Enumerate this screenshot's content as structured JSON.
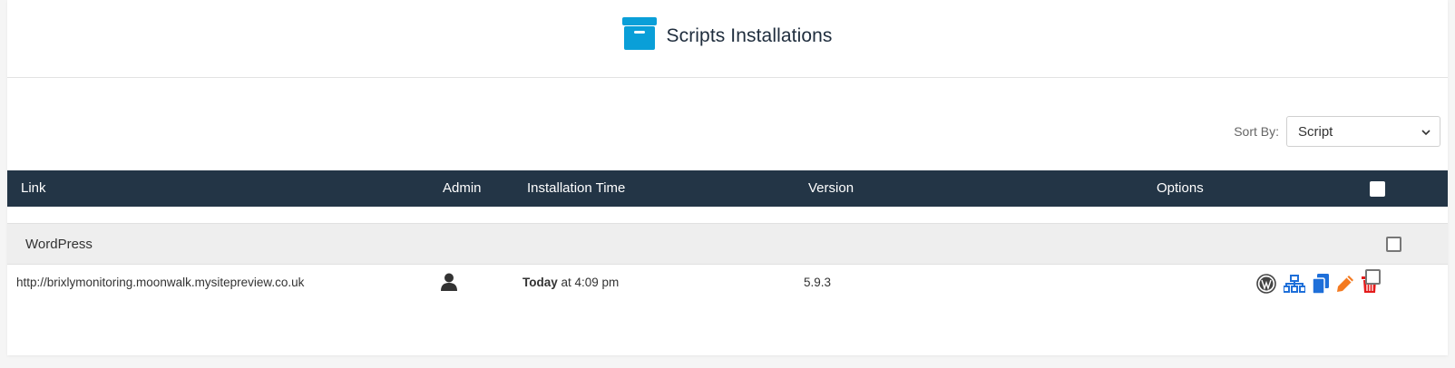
{
  "header": {
    "title": "Scripts Installations",
    "icon": "archive-box-icon"
  },
  "sort": {
    "label": "Sort By:",
    "selected": "Script"
  },
  "table": {
    "columns": {
      "link": "Link",
      "admin": "Admin",
      "installation_time": "Installation Time",
      "version": "Version",
      "options": "Options"
    },
    "groups": [
      {
        "name": "WordPress",
        "rows": [
          {
            "link": "http://brixlymonitoring.moonwalk.mysitepreview.co.uk",
            "time_day": "Today",
            "time_rest": " at 4:09 pm",
            "version": "5.9.3"
          }
        ]
      }
    ]
  },
  "colors": {
    "header_bg": "#233546",
    "accent_blue": "#1e6fd9",
    "icon_cyan": "#0a9fd8",
    "edit_orange": "#f47a20",
    "delete_red": "#e41b1b"
  }
}
